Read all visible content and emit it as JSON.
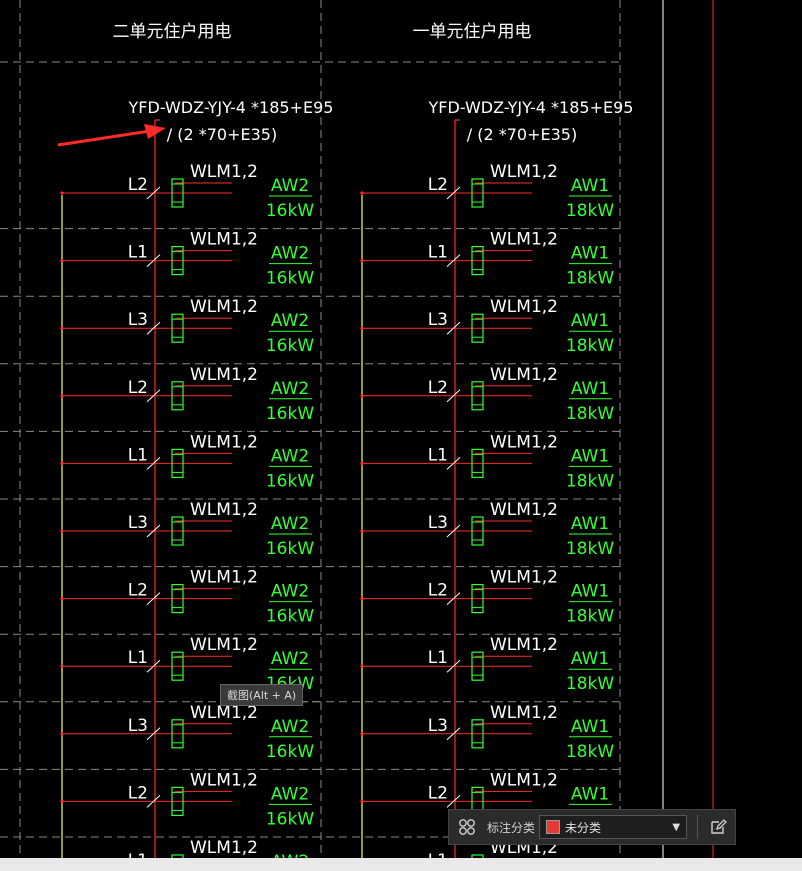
{
  "colors": {
    "background": "#000000",
    "red": "#ff2a2a",
    "yellow": "#ffff55",
    "green": "#33ff33",
    "white": "#ffffff",
    "dashed": "#8a8a8a",
    "accent_red": "#e53935"
  },
  "columns": [
    {
      "header": "二单元住户用电",
      "cable_main": "YFD-WDZ-YJY-4 *185+E95",
      "cable_sub": "/ (2 *70+E35)",
      "rows": [
        {
          "phase": "L2",
          "circuit": "WLM1,2",
          "load": "AW2",
          "power": "16kW"
        },
        {
          "phase": "L1",
          "circuit": "WLM1,2",
          "load": "AW2",
          "power": "16kW"
        },
        {
          "phase": "L3",
          "circuit": "WLM1,2",
          "load": "AW2",
          "power": "16kW"
        },
        {
          "phase": "L2",
          "circuit": "WLM1,2",
          "load": "AW2",
          "power": "16kW"
        },
        {
          "phase": "L1",
          "circuit": "WLM1,2",
          "load": "AW2",
          "power": "16kW"
        },
        {
          "phase": "L3",
          "circuit": "WLM1,2",
          "load": "AW2",
          "power": "16kW"
        },
        {
          "phase": "L2",
          "circuit": "WLM1,2",
          "load": "AW2",
          "power": "16kW"
        },
        {
          "phase": "L1",
          "circuit": "WLM1,2",
          "load": "AW2",
          "power": "16kW"
        },
        {
          "phase": "L3",
          "circuit": "WLM1,2",
          "load": "AW2",
          "power": "16kW"
        },
        {
          "phase": "L2",
          "circuit": "WLM1,2",
          "load": "AW2",
          "power": "16kW"
        },
        {
          "phase": "L1",
          "circuit": "WLM1,2",
          "load": "AW2",
          "power": ""
        }
      ]
    },
    {
      "header": "一单元住户用电",
      "cable_main": "YFD-WDZ-YJY-4 *185+E95",
      "cable_sub": "/ (2 *70+E35)",
      "rows": [
        {
          "phase": "L2",
          "circuit": "WLM1,2",
          "load": "AW1",
          "power": "18kW"
        },
        {
          "phase": "L1",
          "circuit": "WLM1,2",
          "load": "AW1",
          "power": "18kW"
        },
        {
          "phase": "L3",
          "circuit": "WLM1,2",
          "load": "AW1",
          "power": "18kW"
        },
        {
          "phase": "L2",
          "circuit": "WLM1,2",
          "load": "AW1",
          "power": "18kW"
        },
        {
          "phase": "L1",
          "circuit": "WLM1,2",
          "load": "AW1",
          "power": "18kW"
        },
        {
          "phase": "L3",
          "circuit": "WLM1,2",
          "load": "AW1",
          "power": "18kW"
        },
        {
          "phase": "L2",
          "circuit": "WLM1,2",
          "load": "AW1",
          "power": "18kW"
        },
        {
          "phase": "L1",
          "circuit": "WLM1,2",
          "load": "AW1",
          "power": "18kW"
        },
        {
          "phase": "L3",
          "circuit": "WLM1,2",
          "load": "AW1",
          "power": "18kW"
        },
        {
          "phase": "L2",
          "circuit": "WLM1,2",
          "load": "AW1",
          "power": "18kW"
        },
        {
          "phase": "L1",
          "circuit": "WLM1,2",
          "load": "",
          "power": ""
        }
      ]
    }
  ],
  "tooltip": "截图(Alt + A)",
  "toolbar": {
    "grid_icon": "grid-icon",
    "label": "标注分类",
    "selected": "未分类",
    "swatch_color": "#e53935",
    "edit_icon": "edit-icon"
  }
}
